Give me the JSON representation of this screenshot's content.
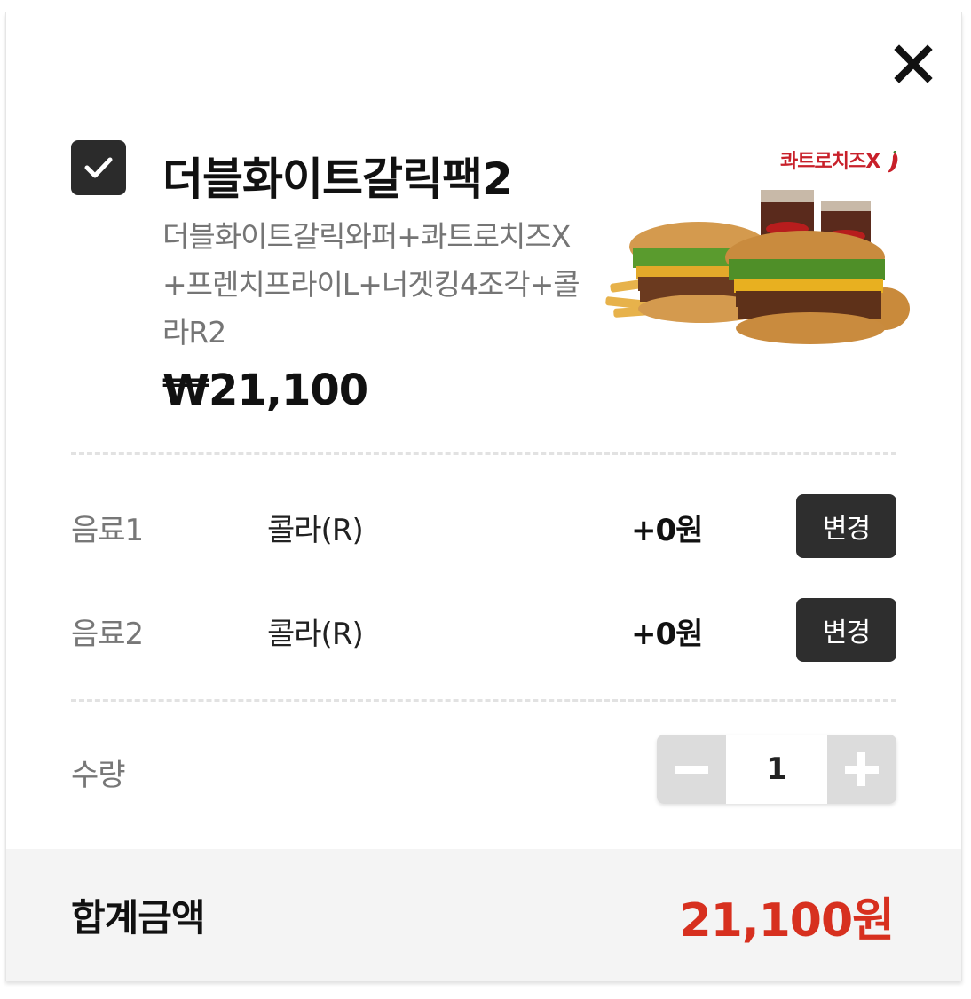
{
  "product": {
    "name": "더블화이트갈릭팩2",
    "description": "더블화이트갈릭와퍼+콰트로치즈X+프렌치프라이L+너겟킹4조각+콜라R2",
    "price": "₩21,100",
    "promo_label": "콰트로치즈X",
    "selected": true
  },
  "options": [
    {
      "label": "음료1",
      "value": "콜라(R)",
      "price": "+0원",
      "button": "변경"
    },
    {
      "label": "음료2",
      "value": "콜라(R)",
      "price": "+0원",
      "button": "변경"
    }
  ],
  "quantity": {
    "label": "수량",
    "value": "1"
  },
  "total": {
    "label": "합계금액",
    "amount": "21,100원"
  },
  "colors": {
    "accent_red": "#d7301f",
    "dark_button": "#2e2e2e",
    "stepper_gray": "#dcdcdc",
    "total_bg": "#f4f4f4"
  },
  "icons": {
    "close": "close-icon",
    "check": "check-icon",
    "minus": "minus-icon",
    "plus": "plus-icon"
  }
}
